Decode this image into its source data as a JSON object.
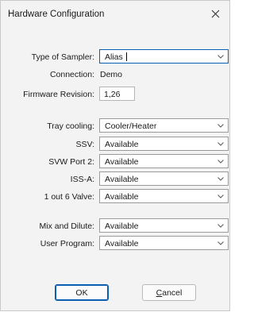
{
  "window": {
    "title": "Hardware Configuration"
  },
  "fields": {
    "sampler_label": "Type of Sampler:",
    "sampler_value": "Alias",
    "connection_label": "Connection:",
    "connection_value": "Demo",
    "firmware_label": "Firmware Revision:",
    "firmware_value": "1,26",
    "tray_label": "Tray cooling:",
    "tray_value": "Cooler/Heater",
    "ssv_label": "SSV:",
    "ssv_value": "Available",
    "svw_label": "SVW Port 2:",
    "svw_value": "Available",
    "issa_label": "ISS-A:",
    "issa_value": "Available",
    "valve_label": "1 out 6 Valve:",
    "valve_value": "Available",
    "mix_label": "Mix and Dilute:",
    "mix_value": "Available",
    "program_label": "User Program:",
    "program_value": "Available"
  },
  "buttons": {
    "ok": "OK",
    "cancel_mnemonic": "C",
    "cancel_rest": "ancel"
  },
  "icons": {
    "close": "close-icon",
    "dropdown": "chevron-down-icon"
  },
  "colors": {
    "accent": "#0b5fb3",
    "dialog_bg": "#f3f3f3"
  }
}
